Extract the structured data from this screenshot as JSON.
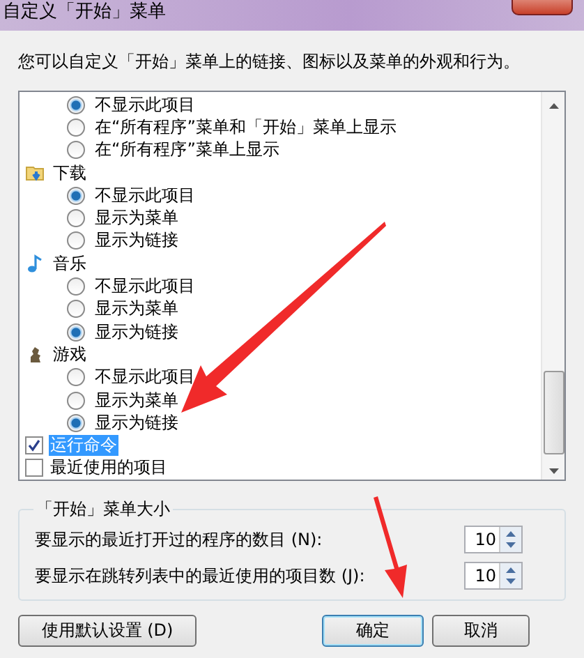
{
  "window": {
    "title": "自定义「开始」菜单"
  },
  "description": "您可以自定义「开始」菜单上的链接、图标以及菜单的外观和行为。",
  "list": {
    "items": [
      {
        "kind": "radio",
        "label": "不显示此项目",
        "selected": true
      },
      {
        "kind": "radio",
        "label": "在“所有程序”菜单和「开始」菜单上显示",
        "selected": false
      },
      {
        "kind": "radio",
        "label": "在“所有程序”菜单上显示",
        "selected": false
      },
      {
        "kind": "header",
        "label": "下载"
      },
      {
        "kind": "radio",
        "label": "不显示此项目",
        "selected": true
      },
      {
        "kind": "radio",
        "label": "显示为菜单",
        "selected": false
      },
      {
        "kind": "radio",
        "label": "显示为链接",
        "selected": false
      },
      {
        "kind": "header",
        "label": "音乐"
      },
      {
        "kind": "radio",
        "label": "不显示此项目",
        "selected": false
      },
      {
        "kind": "radio",
        "label": "显示为菜单",
        "selected": false
      },
      {
        "kind": "radio",
        "label": "显示为链接",
        "selected": true
      },
      {
        "kind": "header",
        "label": "游戏"
      },
      {
        "kind": "radio",
        "label": "不显示此项目",
        "selected": false
      },
      {
        "kind": "radio",
        "label": "显示为菜单",
        "selected": false
      },
      {
        "kind": "radio",
        "label": "显示为链接",
        "selected": true
      },
      {
        "kind": "checkbox",
        "label": "运行命令",
        "checked": true,
        "selected": true
      },
      {
        "kind": "checkbox",
        "label": "最近使用的项目",
        "checked": false,
        "selected": false
      }
    ]
  },
  "size_group": {
    "title": "「开始」菜单大小",
    "rows": [
      {
        "label": "要显示的最近打开过的程序的数目 (N):",
        "value": "10"
      },
      {
        "label": "要显示在跳转列表中的最近使用的项目数 (J):",
        "value": "10"
      }
    ]
  },
  "buttons": [
    {
      "label": "使用默认设置 (D)",
      "default": false
    },
    {
      "label": "确定",
      "default": true
    },
    {
      "label": "取消",
      "default": false
    }
  ]
}
